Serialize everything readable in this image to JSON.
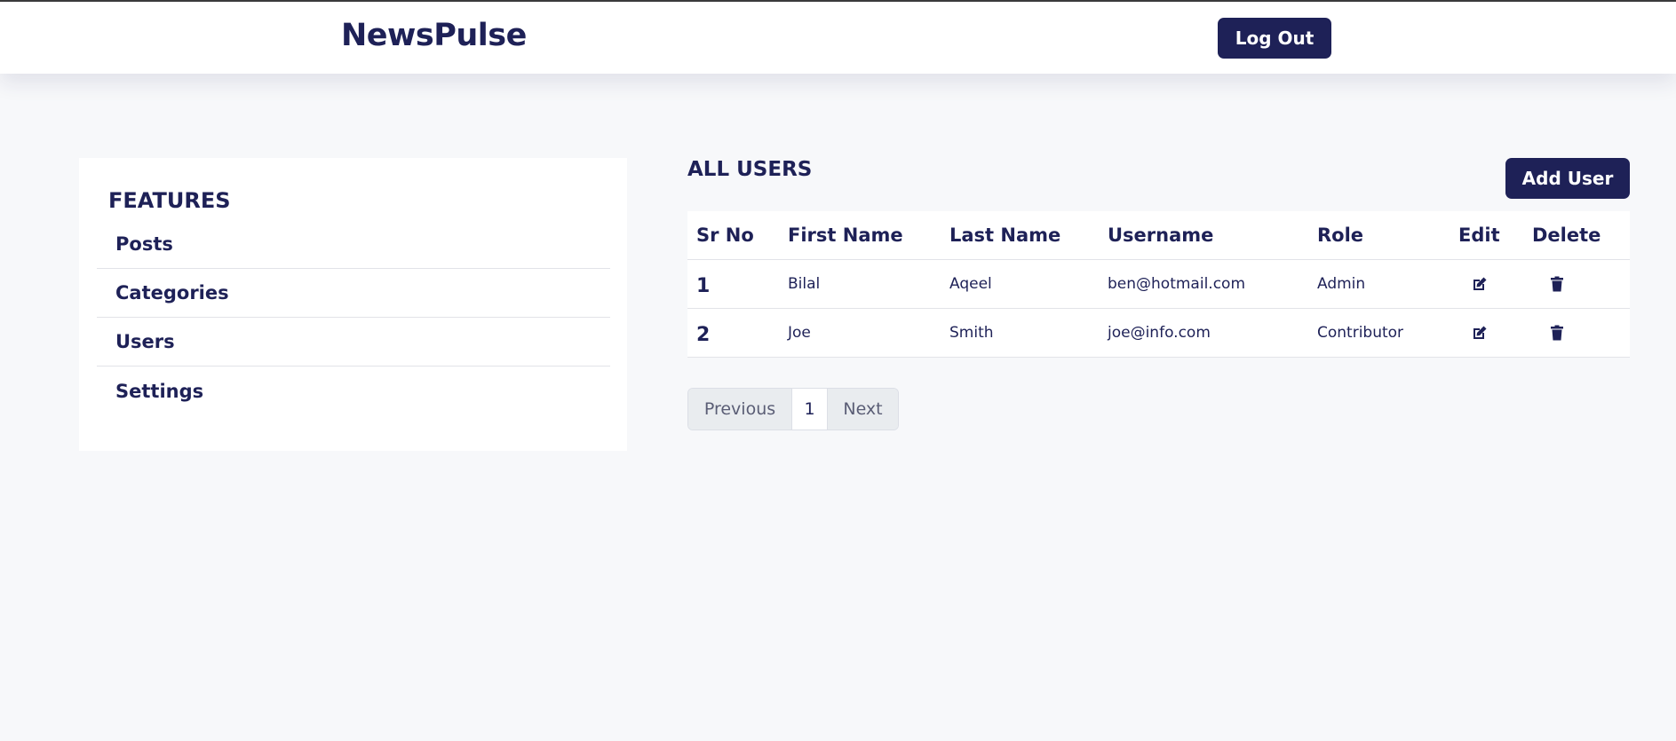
{
  "header": {
    "brand": "NewsPulse",
    "logout_label": "Log Out"
  },
  "sidebar": {
    "title": "FEATURES",
    "items": [
      {
        "label": "Posts"
      },
      {
        "label": "Categories"
      },
      {
        "label": "Users"
      },
      {
        "label": "Settings"
      }
    ]
  },
  "main": {
    "title": "ALL USERS",
    "add_user_label": "Add User",
    "table": {
      "columns": [
        "Sr No",
        "First Name",
        "Last Name",
        "Username",
        "Role",
        "Edit",
        "Delete"
      ],
      "rows": [
        {
          "sr_no": "1",
          "first_name": "Bilal",
          "last_name": "Aqeel",
          "username": "ben@hotmail.com",
          "role": "Admin"
        },
        {
          "sr_no": "2",
          "first_name": "Joe",
          "last_name": "Smith",
          "username": "joe@info.com",
          "role": "Contributor"
        }
      ],
      "row_icons": {
        "edit": "edit-icon",
        "delete": "trash-icon"
      }
    },
    "pagination": {
      "previous_label": "Previous",
      "current_page": "1",
      "next_label": "Next"
    }
  },
  "colors": {
    "primary": "#1e2157",
    "background": "#f7f8fa",
    "surface": "#ffffff",
    "pagination_bg": "#e9ecef"
  }
}
